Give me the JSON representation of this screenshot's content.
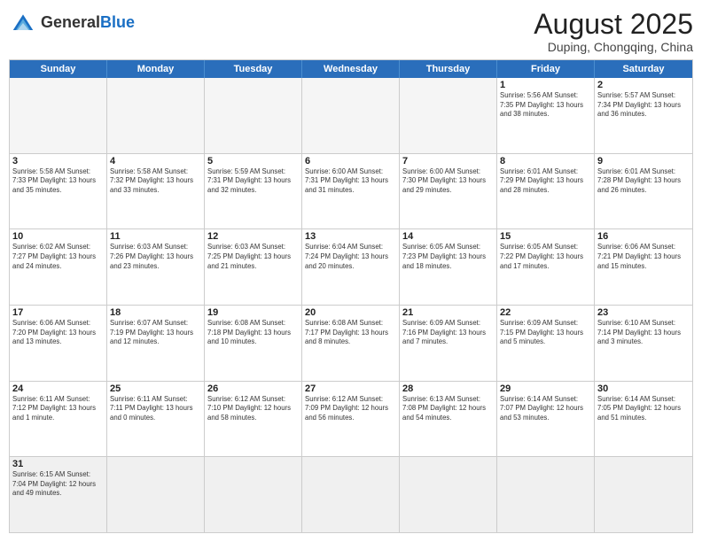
{
  "header": {
    "logo_general": "General",
    "logo_blue": "Blue",
    "month_year": "August 2025",
    "location": "Duping, Chongqing, China"
  },
  "weekdays": [
    "Sunday",
    "Monday",
    "Tuesday",
    "Wednesday",
    "Thursday",
    "Friday",
    "Saturday"
  ],
  "weeks": [
    [
      {
        "day": "",
        "info": ""
      },
      {
        "day": "",
        "info": ""
      },
      {
        "day": "",
        "info": ""
      },
      {
        "day": "",
        "info": ""
      },
      {
        "day": "",
        "info": ""
      },
      {
        "day": "1",
        "info": "Sunrise: 5:56 AM\nSunset: 7:35 PM\nDaylight: 13 hours and 38 minutes."
      },
      {
        "day": "2",
        "info": "Sunrise: 5:57 AM\nSunset: 7:34 PM\nDaylight: 13 hours and 36 minutes."
      }
    ],
    [
      {
        "day": "3",
        "info": "Sunrise: 5:58 AM\nSunset: 7:33 PM\nDaylight: 13 hours and 35 minutes."
      },
      {
        "day": "4",
        "info": "Sunrise: 5:58 AM\nSunset: 7:32 PM\nDaylight: 13 hours and 33 minutes."
      },
      {
        "day": "5",
        "info": "Sunrise: 5:59 AM\nSunset: 7:31 PM\nDaylight: 13 hours and 32 minutes."
      },
      {
        "day": "6",
        "info": "Sunrise: 6:00 AM\nSunset: 7:31 PM\nDaylight: 13 hours and 31 minutes."
      },
      {
        "day": "7",
        "info": "Sunrise: 6:00 AM\nSunset: 7:30 PM\nDaylight: 13 hours and 29 minutes."
      },
      {
        "day": "8",
        "info": "Sunrise: 6:01 AM\nSunset: 7:29 PM\nDaylight: 13 hours and 28 minutes."
      },
      {
        "day": "9",
        "info": "Sunrise: 6:01 AM\nSunset: 7:28 PM\nDaylight: 13 hours and 26 minutes."
      }
    ],
    [
      {
        "day": "10",
        "info": "Sunrise: 6:02 AM\nSunset: 7:27 PM\nDaylight: 13 hours and 24 minutes."
      },
      {
        "day": "11",
        "info": "Sunrise: 6:03 AM\nSunset: 7:26 PM\nDaylight: 13 hours and 23 minutes."
      },
      {
        "day": "12",
        "info": "Sunrise: 6:03 AM\nSunset: 7:25 PM\nDaylight: 13 hours and 21 minutes."
      },
      {
        "day": "13",
        "info": "Sunrise: 6:04 AM\nSunset: 7:24 PM\nDaylight: 13 hours and 20 minutes."
      },
      {
        "day": "14",
        "info": "Sunrise: 6:05 AM\nSunset: 7:23 PM\nDaylight: 13 hours and 18 minutes."
      },
      {
        "day": "15",
        "info": "Sunrise: 6:05 AM\nSunset: 7:22 PM\nDaylight: 13 hours and 17 minutes."
      },
      {
        "day": "16",
        "info": "Sunrise: 6:06 AM\nSunset: 7:21 PM\nDaylight: 13 hours and 15 minutes."
      }
    ],
    [
      {
        "day": "17",
        "info": "Sunrise: 6:06 AM\nSunset: 7:20 PM\nDaylight: 13 hours and 13 minutes."
      },
      {
        "day": "18",
        "info": "Sunrise: 6:07 AM\nSunset: 7:19 PM\nDaylight: 13 hours and 12 minutes."
      },
      {
        "day": "19",
        "info": "Sunrise: 6:08 AM\nSunset: 7:18 PM\nDaylight: 13 hours and 10 minutes."
      },
      {
        "day": "20",
        "info": "Sunrise: 6:08 AM\nSunset: 7:17 PM\nDaylight: 13 hours and 8 minutes."
      },
      {
        "day": "21",
        "info": "Sunrise: 6:09 AM\nSunset: 7:16 PM\nDaylight: 13 hours and 7 minutes."
      },
      {
        "day": "22",
        "info": "Sunrise: 6:09 AM\nSunset: 7:15 PM\nDaylight: 13 hours and 5 minutes."
      },
      {
        "day": "23",
        "info": "Sunrise: 6:10 AM\nSunset: 7:14 PM\nDaylight: 13 hours and 3 minutes."
      }
    ],
    [
      {
        "day": "24",
        "info": "Sunrise: 6:11 AM\nSunset: 7:12 PM\nDaylight: 13 hours and 1 minute."
      },
      {
        "day": "25",
        "info": "Sunrise: 6:11 AM\nSunset: 7:11 PM\nDaylight: 13 hours and 0 minutes."
      },
      {
        "day": "26",
        "info": "Sunrise: 6:12 AM\nSunset: 7:10 PM\nDaylight: 12 hours and 58 minutes."
      },
      {
        "day": "27",
        "info": "Sunrise: 6:12 AM\nSunset: 7:09 PM\nDaylight: 12 hours and 56 minutes."
      },
      {
        "day": "28",
        "info": "Sunrise: 6:13 AM\nSunset: 7:08 PM\nDaylight: 12 hours and 54 minutes."
      },
      {
        "day": "29",
        "info": "Sunrise: 6:14 AM\nSunset: 7:07 PM\nDaylight: 12 hours and 53 minutes."
      },
      {
        "day": "30",
        "info": "Sunrise: 6:14 AM\nSunset: 7:05 PM\nDaylight: 12 hours and 51 minutes."
      }
    ],
    [
      {
        "day": "31",
        "info": "Sunrise: 6:15 AM\nSunset: 7:04 PM\nDaylight: 12 hours and 49 minutes."
      },
      {
        "day": "",
        "info": ""
      },
      {
        "day": "",
        "info": ""
      },
      {
        "day": "",
        "info": ""
      },
      {
        "day": "",
        "info": ""
      },
      {
        "day": "",
        "info": ""
      },
      {
        "day": "",
        "info": ""
      }
    ]
  ]
}
